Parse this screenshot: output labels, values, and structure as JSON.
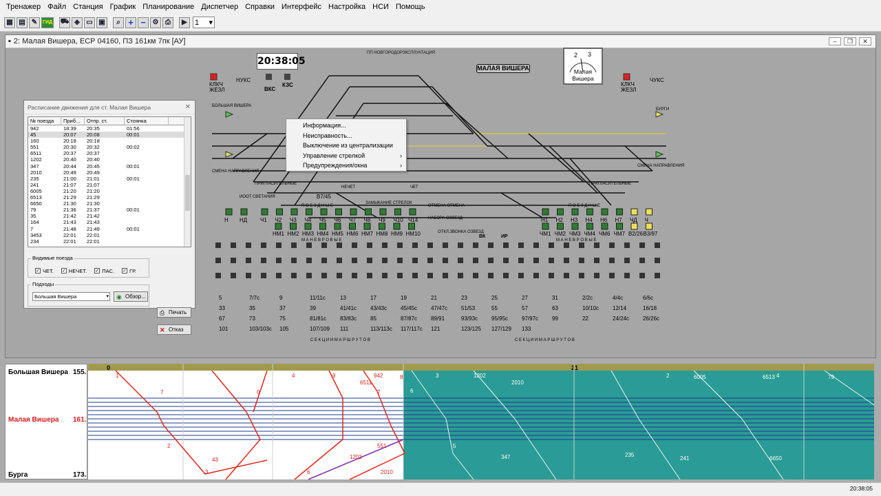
{
  "menubar": {
    "items": [
      "Тренажер",
      "Файл",
      "Станция",
      "График",
      "Планирование",
      "Диспетчер",
      "Справки",
      "Интерфейс",
      "Настройка",
      "НСИ",
      "Помощь"
    ]
  },
  "toolbar": {
    "gid_label": "ГИД",
    "zoom_value": "1"
  },
  "window": {
    "title": "2: Малая Вишера, ЕСР 04160, ПЗ 161км 7пк [АУ]"
  },
  "scheme": {
    "clock": "20:38:05",
    "station_name": "МАЛАЯ ВИШЕРА",
    "gauge_label": "Малая Вишера",
    "gauge_scale": [
      "2",
      "3"
    ],
    "header_label": "ПП НОВГОРОДОРЗКСПЛУАТАЦИЯ",
    "left_block": {
      "klk": "КЛКЧ",
      "zhezl": "ЖЕЗЛ",
      "nuks": "НУКС",
      "vks": "ВКС",
      "kzs": "КЗС",
      "bolshaya": "БОЛЬШАЯ ВИШЕРА",
      "smena": "СМЕНА НАПРАВЛЕНИЯ",
      "ioot": "ИООТ СВЕТАНИЯ",
      "priglas": "ПРИГЛАСИТЕЛЬНЫЕ"
    },
    "right_block": {
      "klk": "КЛКЧ",
      "zhezl": "ЖЕЗЛ",
      "chuks": "ЧУКС",
      "burgi": "БУРГИ",
      "smena": "СМЕНА НАПРАВЛЕНИЯ",
      "priglas": "ПРИГЛАСИТЕЛЬНЫЕ"
    },
    "labels_mid": {
      "nechet": "НЕЧЕТ",
      "chet": "ЧЕТ",
      "zamykanie": "ЗАМЫКАНИЕ СТРЕЛОК",
      "otmena": "ОТМЕНА ОТМЕНА",
      "nabora": "НАБОРА ОЗВЕЗД",
      "otkl": "ОТКЛ.ЗВОНКА ОЗВЕЗД",
      "vk": "ВК",
      "ir": "ИР",
      "v7_45": "В7/45",
      "pz": "П О Е З Д Н Ы Е",
      "man": "М А Н Е В Р О В Ы Е",
      "sekcii": "С Е К Ц И И   М А Р Ш Р У Т О В"
    },
    "left_signals_row1": [
      "Н",
      "НД",
      "Ч1",
      "Ч2",
      "Ч3",
      "Ч4",
      "Ч5",
      "Ч6",
      "Ч7",
      "Ч8",
      "Ч9",
      "Ч10",
      "Ч14"
    ],
    "left_signals_row2": [
      "НМ1",
      "НМ2",
      "НМ3",
      "НМ4",
      "НМ5",
      "НМ6",
      "НМ7",
      "НМ8",
      "НМ9",
      "НМ10"
    ],
    "right_signals_row1": [
      "Н1",
      "Н2",
      "Н3",
      "Н4",
      "Н6",
      "Н7",
      "ЧД",
      "Ч"
    ],
    "right_signals_row2": [
      "ЧМ1",
      "ЧМ2",
      "ЧМ3",
      "ЧМ4",
      "ЧМ6",
      "ЧМ7",
      "В2/26",
      "В3/97"
    ],
    "route_numbers": [
      "5",
      "7/7с",
      "9",
      "11/11с",
      "13",
      "17",
      "19",
      "21",
      "23",
      "25",
      "27",
      "31",
      "33",
      "35",
      "37",
      "39",
      "41/41с",
      "43/43с",
      "45/45с",
      "47/47с",
      "51/53",
      "55",
      "57",
      "63",
      "67",
      "73",
      "75",
      "81/81с",
      "83/83с",
      "85",
      "87/87с",
      "89/91",
      "93/93с",
      "95/95с",
      "97/97с",
      "99",
      "101",
      "103/103с",
      "105",
      "107/109",
      "111",
      "113/113с",
      "117/117с",
      "121",
      "123/125",
      "127/129",
      "133",
      "2/2с",
      "4/4с",
      "6/6с",
      "10/10с",
      "12/14",
      "16/18",
      "22",
      "24/24с",
      "26/26с"
    ]
  },
  "context_menu": {
    "items": [
      {
        "label": "Информация...",
        "submenu": false
      },
      {
        "label": "Неисправность...",
        "submenu": false
      },
      {
        "label": "Выключение из централизации",
        "submenu": false
      },
      {
        "label": "Управление стрелкой",
        "submenu": true
      },
      {
        "label": "Предупреждения/окна",
        "submenu": true
      }
    ]
  },
  "schedule": {
    "title": "Расписание движения для ст. Малая Вишера",
    "headers": [
      "№ поезда",
      "Приб...",
      "Отпр. ст.",
      "Стоянка"
    ],
    "rows": [
      [
        "942",
        "18:39",
        "20:35",
        "01:56"
      ],
      [
        "45",
        "20:07",
        "20:08",
        "00:01"
      ],
      [
        "160",
        "20:18",
        "20:18",
        ""
      ],
      [
        "551",
        "20:30",
        "20:32",
        "00:02"
      ],
      [
        "6511",
        "20:37",
        "20:37",
        ""
      ],
      [
        "1202",
        "20:40",
        "20:40",
        ""
      ],
      [
        "347",
        "20:44",
        "20:45",
        "00:01"
      ],
      [
        "2010",
        "20:49",
        "20:49",
        ""
      ],
      [
        "235",
        "21:00",
        "21:01",
        "00:01"
      ],
      [
        "241",
        "21:07",
        "21:07",
        ""
      ],
      [
        "6005",
        "21:20",
        "21:20",
        ""
      ],
      [
        "6513",
        "21:29",
        "21:29",
        ""
      ],
      [
        "6650",
        "21:30",
        "21:30",
        ""
      ],
      [
        "79",
        "21:36",
        "21:37",
        "00:01"
      ],
      [
        "35",
        "21:42",
        "21:42",
        ""
      ],
      [
        "164",
        "21:43",
        "21:43",
        ""
      ],
      [
        "7",
        "21:48",
        "21:49",
        "00:01"
      ],
      [
        "3453",
        "22:01",
        "22:01",
        ""
      ],
      [
        "234",
        "22:01",
        "22:01",
        ""
      ]
    ],
    "visible_trains_label": "Видимые поезда",
    "checks": [
      "ЧЕТ.",
      "НЕЧЕТ.",
      "ПАС.",
      "ГР."
    ],
    "approaches_label": "Подходы",
    "approach_value": "Большая Вишера",
    "browse_label": "Обзор...",
    "print_label": "Печать",
    "cancel_label": "Отказ"
  },
  "graph": {
    "stations": [
      {
        "name": "Большая Вишера",
        "km": "155."
      },
      {
        "name": "Малая Вишера",
        "km": "161."
      },
      {
        "name": "Бурга",
        "km": "173."
      }
    ],
    "hours": [
      "0",
      "21"
    ],
    "train_labels": [
      "1",
      "7",
      "4",
      "9",
      "6511",
      "942",
      "3",
      "1202",
      "7",
      "2010",
      "8",
      "6005",
      "6513",
      "79",
      "6",
      "0",
      "5",
      "347",
      "235",
      "241",
      "6650",
      "2",
      "4",
      "551",
      "1202",
      "2010",
      "3",
      "6",
      "43",
      "2"
    ],
    "colors": {
      "past_bg": "#ffffff",
      "future_bg": "#2a9b96",
      "red": "#e0261c",
      "purple": "#7a2aa8",
      "line": "#1e3a8a"
    }
  },
  "status": {
    "time": "20:38:05"
  }
}
